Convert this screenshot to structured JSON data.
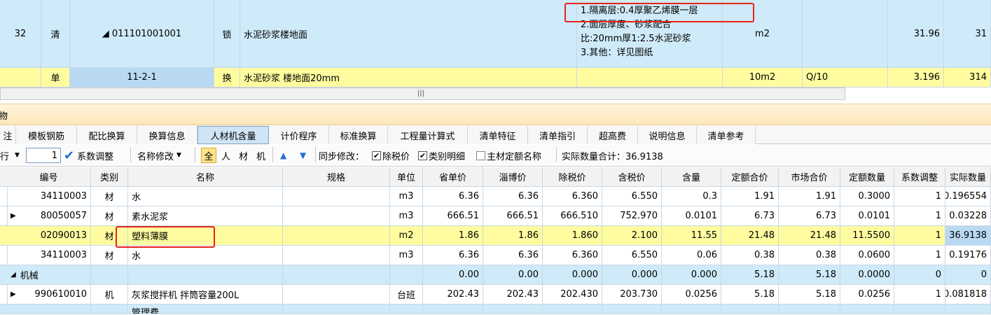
{
  "top_rows": [
    {
      "seq": "32",
      "type": "清",
      "code": "◢ 011101001001",
      "flag": "锁",
      "name": "水泥砂浆楼地面",
      "feature_lines": [
        "1.隔离层:0.4厚聚乙烯膜一层",
        "2.面层厚度、砂浆配合",
        "比:20mm厚1:2.5水泥砂浆",
        "3.其他：详见图纸"
      ],
      "unit": "m2",
      "expr": "",
      "qty": "31.96",
      "extra": "31"
    },
    {
      "seq": "",
      "type": "单",
      "code": "11-2-1",
      "flag": "换",
      "name": "水泥砂浆 楼地面20mm",
      "feature_lines": [],
      "unit": "10m2",
      "expr": "Q/10",
      "qty": "3.196",
      "extra": "314"
    }
  ],
  "panel_title": "物",
  "tabs": [
    "注",
    "模板钢筋",
    "配比换算",
    "换算信息",
    "人材机含量",
    "计价程序",
    "标准换算",
    "工程量计算式",
    "清单特征",
    "清单指引",
    "超高费",
    "说明信息",
    "清单参考"
  ],
  "active_tab": "人材机含量",
  "toolbar": {
    "row_label": "行",
    "coef_value": "1",
    "coef_adjust": "系数调整",
    "name_edit": "名称修改",
    "filters": [
      "全",
      "人",
      "材",
      "机"
    ],
    "sync_label": "同步修改：",
    "chk_ex_tax": "除税价",
    "chk_category": "类别明细",
    "chk_main": "主材定额名称",
    "total_label": "实际数量合计：36.9138"
  },
  "columns": [
    "编号",
    "类别",
    "名称",
    "规格",
    "单位",
    "省单价",
    "淄博价",
    "除税价",
    "含税价",
    "含量",
    "定额合价",
    "市场合价",
    "定额数量",
    "系数调整",
    "实际数量"
  ],
  "rows": [
    {
      "kind": "normal",
      "expand": "",
      "code": "34110003",
      "cat": "材",
      "name": "水",
      "spec": "",
      "unit": "m3",
      "p1": "6.36",
      "p2": "6.36",
      "p3": "6.360",
      "p4": "6.550",
      "content": "0.3",
      "t1": "1.91",
      "t2": "1.91",
      "dq": "0.3000",
      "coef": "1",
      "actual": "0.196554"
    },
    {
      "kind": "normal",
      "expand": "▶",
      "code": "80050057",
      "cat": "材",
      "name": "素水泥浆",
      "spec": "",
      "unit": "m3",
      "p1": "666.51",
      "p2": "666.51",
      "p3": "666.510",
      "p4": "752.970",
      "content": "0.0101",
      "t1": "6.73",
      "t2": "6.73",
      "dq": "0.0101",
      "coef": "1",
      "actual": "0.03228"
    },
    {
      "kind": "selected",
      "expand": "",
      "code": "02090013",
      "cat": "材",
      "name": "塑料薄膜",
      "spec": "",
      "unit": "m2",
      "p1": "1.86",
      "p2": "1.86",
      "p3": "1.860",
      "p4": "2.100",
      "content": "11.55",
      "t1": "21.48",
      "t2": "21.48",
      "dq": "11.5500",
      "coef": "1",
      "actual": "36.9138"
    },
    {
      "kind": "normal",
      "expand": "",
      "code": "34110003",
      "cat": "材",
      "name": "水",
      "spec": "",
      "unit": "m3",
      "p1": "6.36",
      "p2": "6.36",
      "p3": "6.360",
      "p4": "6.550",
      "content": "0.06",
      "t1": "0.38",
      "t2": "0.38",
      "dq": "0.0600",
      "coef": "1",
      "actual": "0.19176"
    },
    {
      "kind": "group",
      "expand": "◢",
      "code": "机械",
      "cat": "",
      "name": "",
      "spec": "",
      "unit": "",
      "p1": "0.00",
      "p2": "0.00",
      "p3": "0.000",
      "p4": "0.000",
      "content": "0.000",
      "t1": "5.18",
      "t2": "5.18",
      "dq": "0.0000",
      "coef": "0",
      "actual": "0"
    },
    {
      "kind": "normal",
      "expand": "▶",
      "code": "990610010",
      "cat": "机",
      "name": "灰浆搅拌机 拌筒容量200L",
      "spec": "",
      "unit": "台班",
      "p1": "202.43",
      "p2": "202.43",
      "p3": "202.430",
      "p4": "203.730",
      "content": "0.0256",
      "t1": "5.18",
      "t2": "5.18",
      "dq": "0.0256",
      "coef": "1",
      "actual": "0.081818"
    }
  ],
  "partial_last_row": {
    "name": "管理费"
  },
  "colors": {
    "highlight_box": "#e8231c",
    "row_blue": "#cfeaf8",
    "row_yellow": "#fffca0",
    "selected_cell": "#b9d9f3"
  }
}
